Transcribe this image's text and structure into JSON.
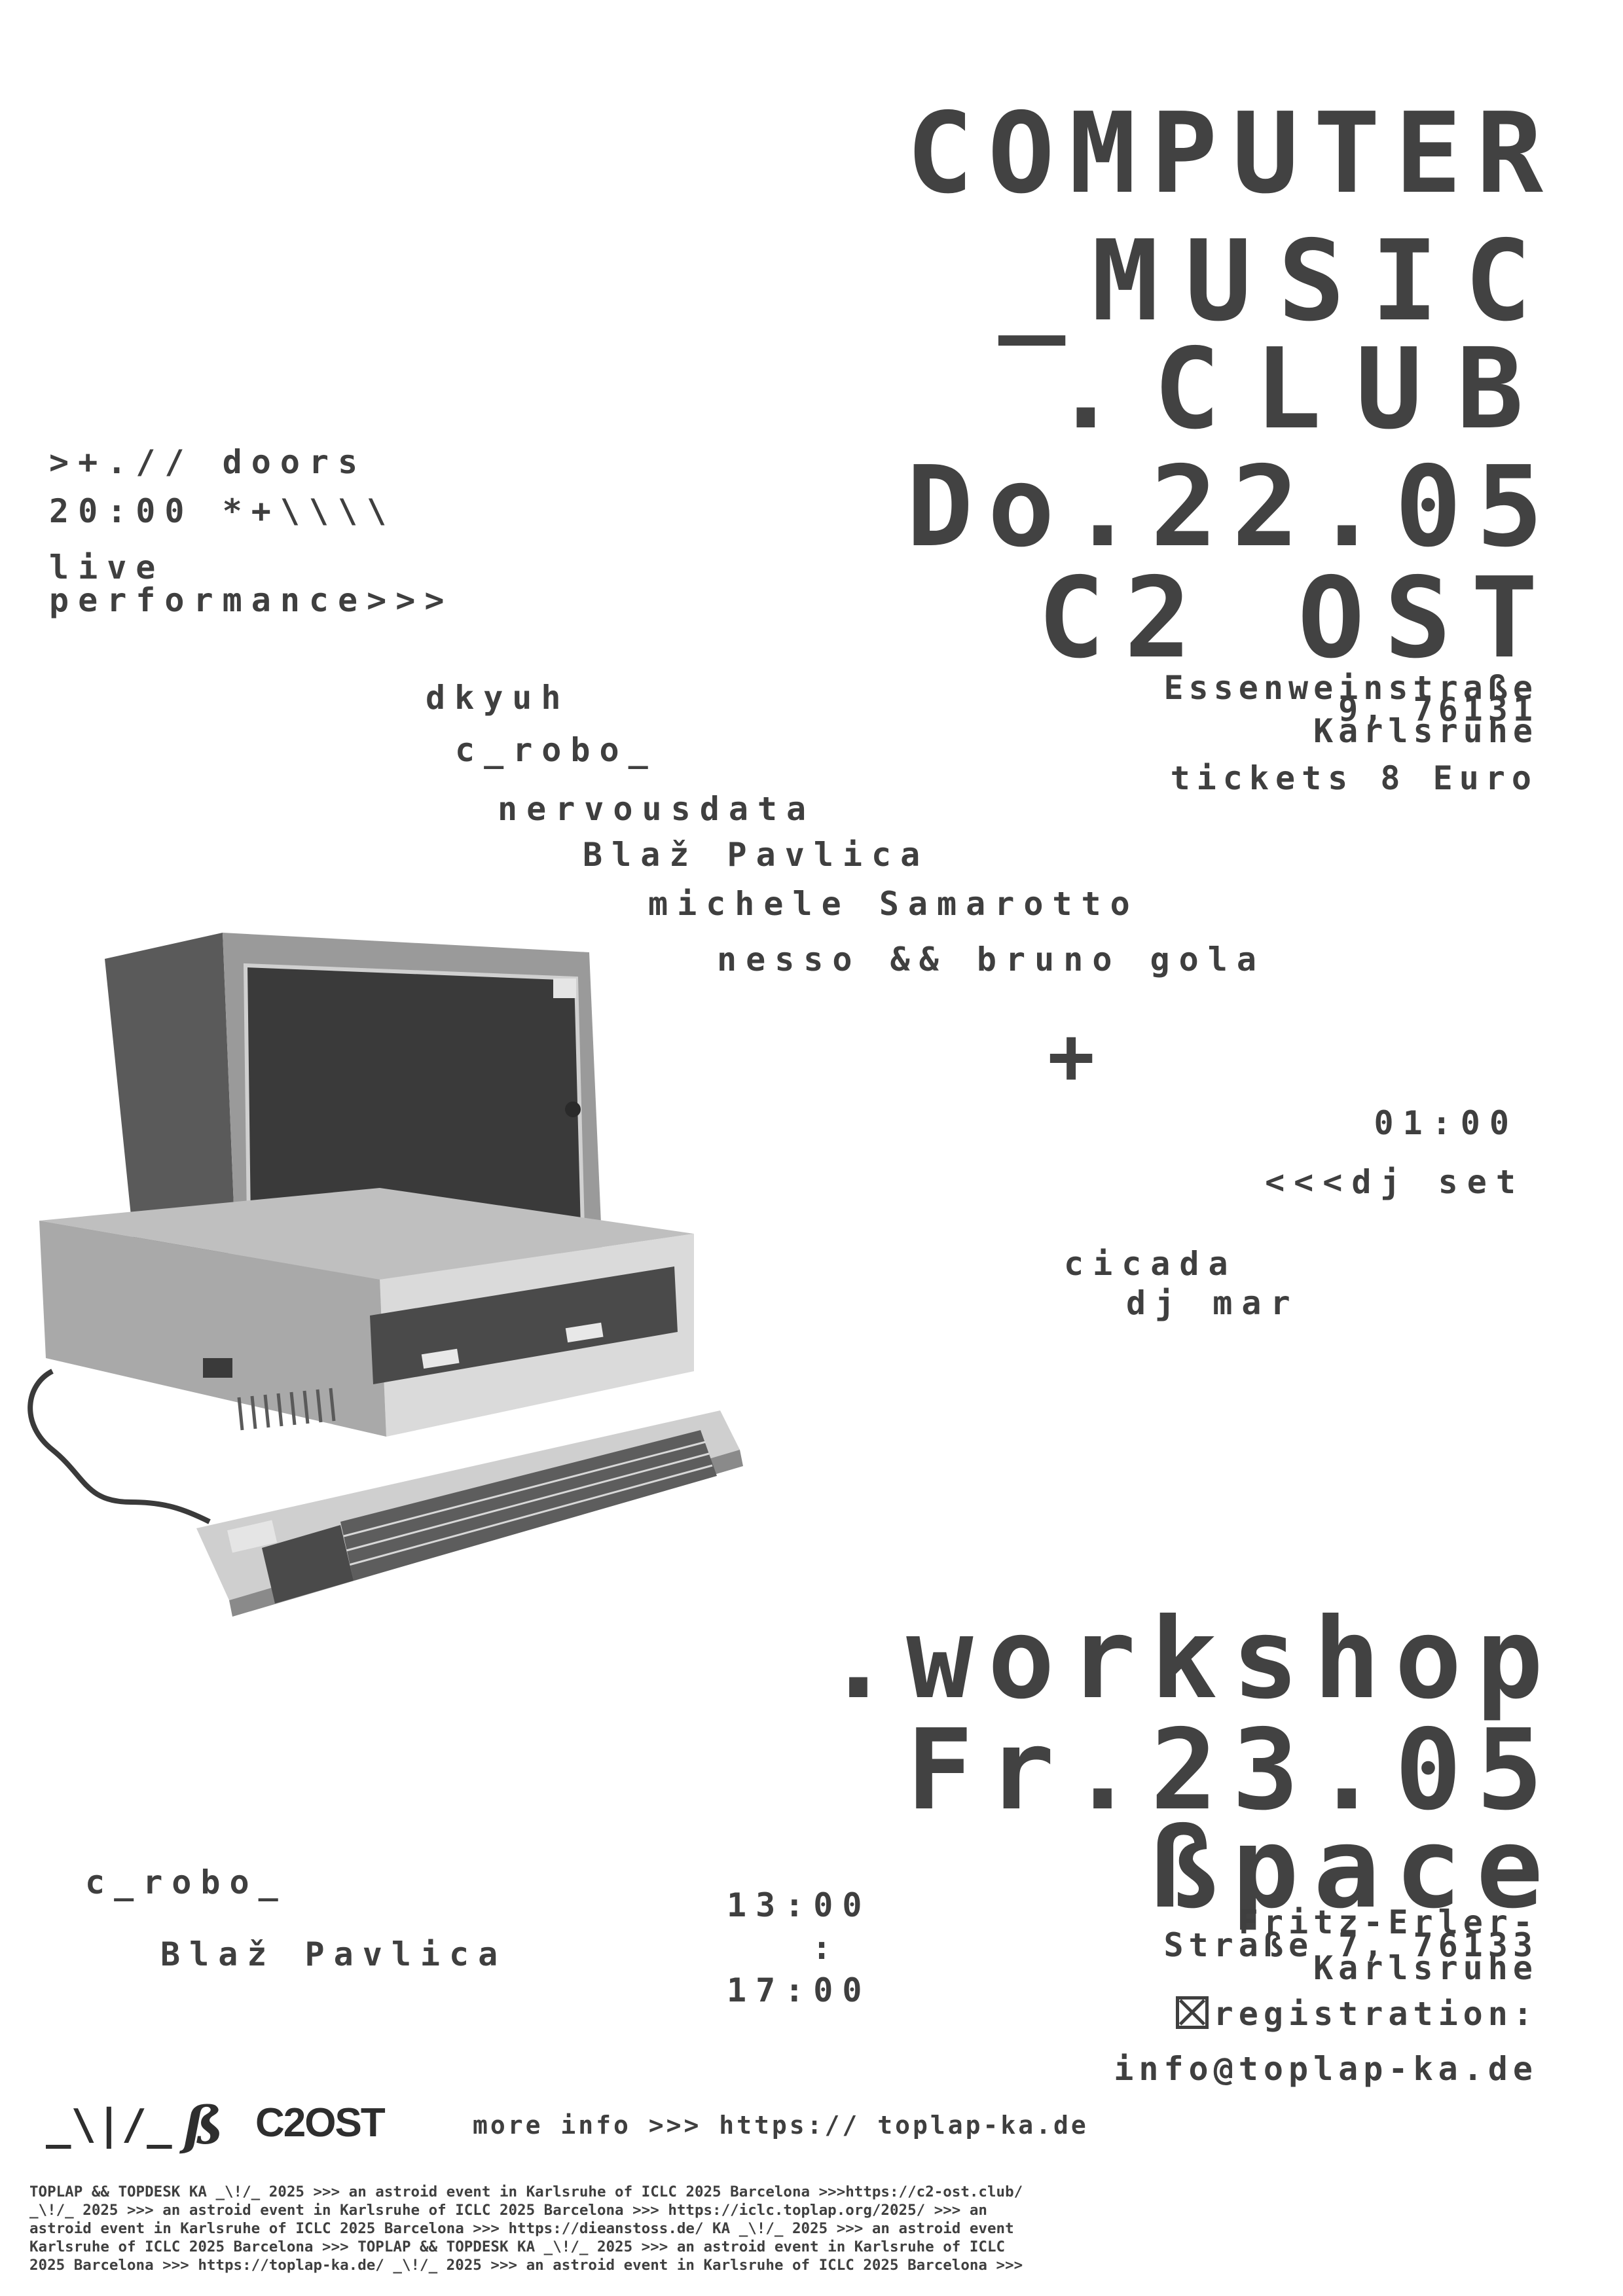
{
  "title": {
    "line1": "COMPUTER",
    "line2": "_MUSIC",
    "line3": ".CLUB",
    "date": "Do.22.05",
    "venue": "C2 OST"
  },
  "doors": {
    "line1": ">+.// doors",
    "line2": "20:00 *+\\\\\\\\",
    "line3": "live",
    "line4": "performance>>>"
  },
  "address1": {
    "line1": "Essenweinstraße",
    "line2": "9, 76131",
    "line3": "Karlsruhe",
    "tickets": "tickets 8 Euro"
  },
  "performers": [
    "dkyuh",
    "c_robo_",
    "nervousdata",
    "Blaž Pavlica",
    "michele Samarotto",
    "nesso && bruno gola"
  ],
  "plus": "+",
  "dj": {
    "time": "01:00",
    "label": "<<<dj set",
    "names": [
      "cicada",
      "dj mar"
    ]
  },
  "workshop": {
    "title": ".workshop",
    "date": "Fr.23.05",
    "venue": "ßpace",
    "hosts": [
      "c_robo_",
      "Blaž Pavlica"
    ],
    "time_start": "13:00",
    "time_sep": ":",
    "time_end": "17:00",
    "addr_line1": "Fritz-Erler-",
    "addr_line2": "Straße 7, 76133",
    "addr_line3": "Karlsruhe",
    "registration": "registration:",
    "email": "info@toplap-ka.de"
  },
  "footer_bar": {
    "logo_toplap": "_\\|/_",
    "logo_space": "ß",
    "logo_c2": "C2OST",
    "more_info": "more info >>> https:// toplap-ka.de"
  },
  "footer_lines": [
    "TOPLAP && TOPDESK KA _\\!/_ 2025 >>> an astroid event in Karlsruhe of ICLC 2025 Barcelona >>>https://c2-ost.club/",
    "_\\!/_ 2025 >>> an astroid event in Karlsruhe of ICLC 2025 Barcelona >>> https://iclc.toplap.org/2025/ >>> an",
    "astroid event in Karlsruhe of ICLC 2025 Barcelona >>> https://dieanstoss.de/ KA _\\!/_ 2025 >>> an astroid event",
    "Karlsruhe of ICLC 2025 Barcelona >>> TOPLAP && TOPDESK KA _\\!/_ 2025 >>> an astroid event in Karlsruhe of ICLC",
    "2025 Barcelona >>> https://toplap-ka.de/ _\\!/_ 2025 >>> an astroid event in Karlsruhe of ICLC 2025 Barcelona >>>"
  ],
  "image_desc": "vintage-personal-computer"
}
